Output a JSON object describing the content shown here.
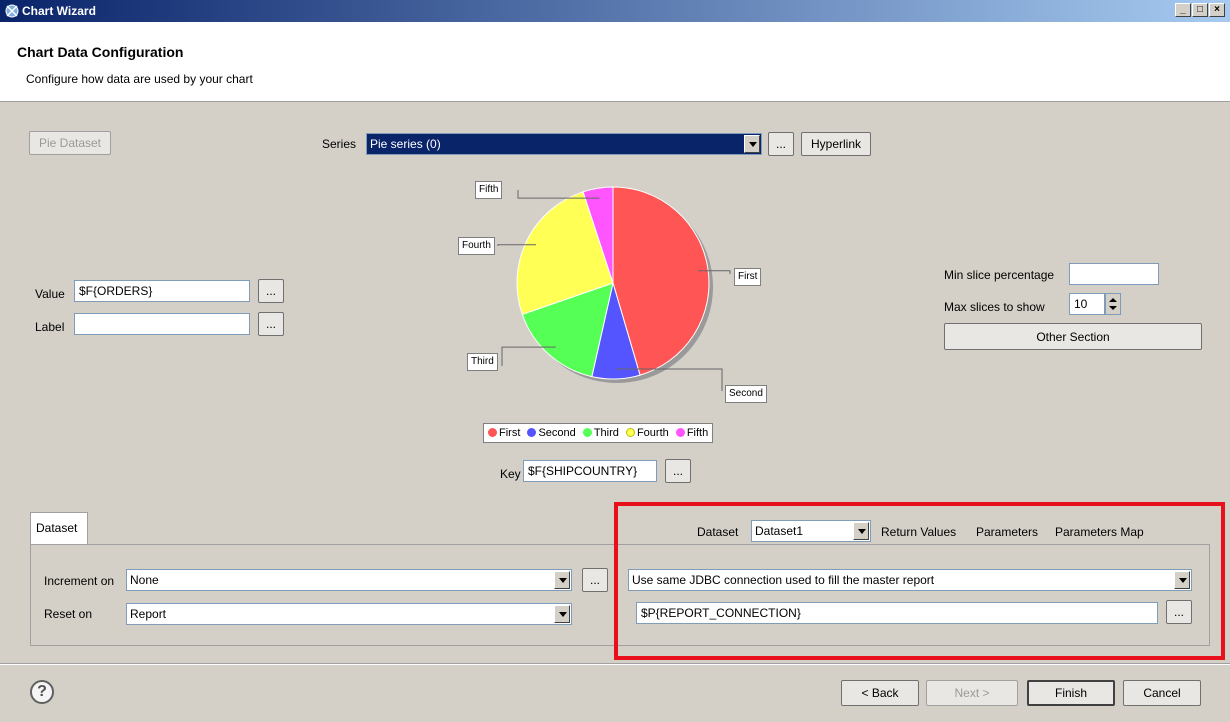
{
  "window": {
    "title": "Chart Wizard"
  },
  "header": {
    "title": "Chart Data Configuration",
    "subtitle": "Configure how data are used by your chart"
  },
  "pie_dataset_button": "Pie Dataset",
  "series": {
    "label": "Series",
    "value": "Pie series (0)",
    "ellipsis": "...",
    "hyperlink": "Hyperlink"
  },
  "value_field": {
    "label": "Value",
    "value": "$F{ORDERS}",
    "ellipsis": "..."
  },
  "label_field": {
    "label": "Label",
    "value": "",
    "ellipsis": "..."
  },
  "chart_data": {
    "type": "pie",
    "categories": [
      "First",
      "Second",
      "Third",
      "Fourth",
      "Fifth"
    ],
    "values": [
      45,
      8,
      16,
      25,
      5
    ],
    "colors": [
      "#ff5555",
      "#5555ff",
      "#55ff55",
      "#ffff55",
      "#ff55ff"
    ]
  },
  "key_field": {
    "label": "Key",
    "value": "$F{SHIPCOUNTRY}",
    "ellipsis": "..."
  },
  "right_panel": {
    "min_slice_label": "Min slice percentage",
    "min_slice_value": "",
    "max_slices_label": "Max slices to show",
    "max_slices_value": "10",
    "other_section": "Other Section"
  },
  "dataset_tab": {
    "label": "Dataset"
  },
  "increment": {
    "label": "Increment on",
    "value": "None",
    "ellipsis": "..."
  },
  "reset": {
    "label": "Reset on",
    "value": "Report"
  },
  "dataset_run": {
    "dataset_label": "Dataset",
    "dataset_value": "Dataset1",
    "return_values": "Return Values",
    "parameters": "Parameters",
    "parameters_map": "Parameters Map",
    "connection_mode": "Use same JDBC connection used to fill the master report",
    "connection_expr": "$P{REPORT_CONNECTION}",
    "ellipsis": "..."
  },
  "footer": {
    "help": "?",
    "back": "< Back",
    "next": "Next >",
    "finish": "Finish",
    "cancel": "Cancel"
  }
}
